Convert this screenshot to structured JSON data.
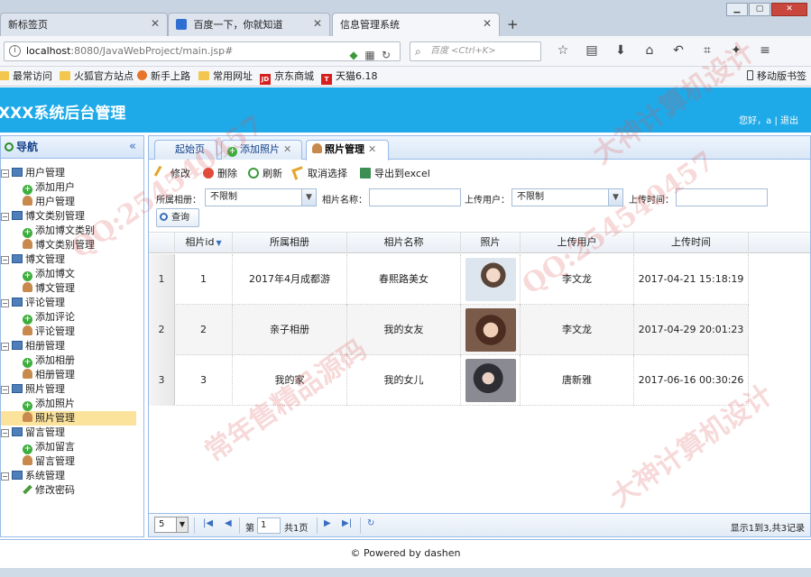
{
  "browser": {
    "tabs": [
      {
        "label": "新标签页",
        "active": false
      },
      {
        "label": "百度一下，你就知道",
        "active": false
      },
      {
        "label": "信息管理系统",
        "active": true
      }
    ],
    "url_host": "localhost",
    "url_path": ":8080/JavaWebProject/main.jsp#",
    "search_placeholder": "百度 <Ctrl+K>",
    "bookmarks": [
      "最常访问",
      "火狐官方站点",
      "新手上路",
      "常用网址",
      "京东商城",
      "天猫6.18"
    ],
    "mobile_bookmarks": "移动版书签"
  },
  "header": {
    "title": "XXX系统后台管理",
    "user_greeting": "您好，a",
    "separator": "|",
    "logout": "退出"
  },
  "nav": {
    "title": "导航",
    "groups": [
      {
        "label": "用户管理",
        "items": [
          {
            "label": "添加用户",
            "type": "add"
          },
          {
            "label": "用户管理",
            "type": "manage"
          }
        ]
      },
      {
        "label": "博文类别管理",
        "items": [
          {
            "label": "添加博文类别",
            "type": "add"
          },
          {
            "label": "博文类别管理",
            "type": "manage"
          }
        ]
      },
      {
        "label": "博文管理",
        "items": [
          {
            "label": "添加博文",
            "type": "add"
          },
          {
            "label": "博文管理",
            "type": "manage"
          }
        ]
      },
      {
        "label": "评论管理",
        "items": [
          {
            "label": "添加评论",
            "type": "add"
          },
          {
            "label": "评论管理",
            "type": "manage"
          }
        ]
      },
      {
        "label": "相册管理",
        "items": [
          {
            "label": "添加相册",
            "type": "add"
          },
          {
            "label": "相册管理",
            "type": "manage"
          }
        ]
      },
      {
        "label": "照片管理",
        "items": [
          {
            "label": "添加照片",
            "type": "add"
          },
          {
            "label": "照片管理",
            "type": "manage",
            "selected": true
          }
        ]
      },
      {
        "label": "留言管理",
        "items": [
          {
            "label": "添加留言",
            "type": "add"
          },
          {
            "label": "留言管理",
            "type": "manage"
          }
        ]
      },
      {
        "label": "系统管理",
        "items": [
          {
            "label": "修改密码",
            "type": "edit"
          }
        ]
      }
    ]
  },
  "content_tabs": [
    {
      "label": "起始页",
      "closable": false
    },
    {
      "label": "添加照片",
      "closable": true
    },
    {
      "label": "照片管理",
      "closable": true,
      "active": true
    }
  ],
  "toolbar": {
    "edit": "修改",
    "delete": "删除",
    "refresh": "刷新",
    "cancel_select": "取消选择",
    "export": "导出到excel"
  },
  "filter": {
    "album_label": "所属相册：",
    "album_value": "不限制",
    "photo_name_label": "相片名称：",
    "photo_name_value": "",
    "uploader_label": "上传用户：",
    "uploader_value": "不限制",
    "upload_time_label": "上传时间：",
    "upload_time_value": "",
    "query_button": "查询"
  },
  "grid": {
    "columns": [
      "相片id",
      "所属相册",
      "相片名称",
      "照片",
      "上传用户",
      "上传时间"
    ],
    "rows": [
      {
        "num": "1",
        "id": "1",
        "album": "2017年4月成都游",
        "name": "春熙路美女",
        "uploader": "李文龙",
        "time": "2017-04-21 15:18:19"
      },
      {
        "num": "2",
        "id": "2",
        "album": "亲子相册",
        "name": "我的女友",
        "uploader": "李文龙",
        "time": "2017-04-29 20:01:23"
      },
      {
        "num": "3",
        "id": "3",
        "album": "我的家",
        "name": "我的女儿",
        "uploader": "唐新雅",
        "time": "2017-06-16 00:30:26"
      }
    ]
  },
  "pager": {
    "page_size": "5",
    "page_prefix": "第",
    "page_value": "1",
    "page_suffix": "共1页",
    "info": "显示1到3,共3记录"
  },
  "footer": {
    "text": "© Powered by dashen"
  },
  "watermarks": [
    "QQ:254540457",
    "常年售精品源码",
    "大神计算机设计"
  ]
}
